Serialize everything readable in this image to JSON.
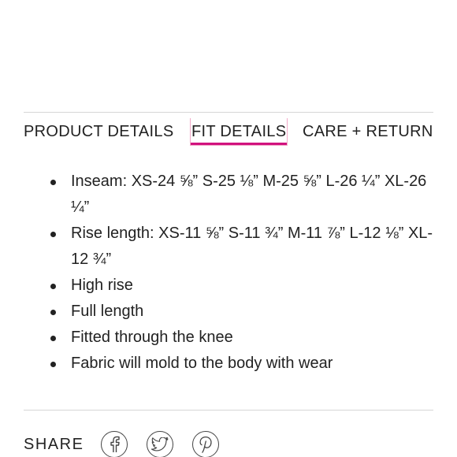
{
  "tabs": [
    {
      "label": "PRODUCT DETAILS",
      "active": false
    },
    {
      "label": "FIT DETAILS",
      "active": true
    },
    {
      "label": "CARE + RETURNS",
      "active": false
    }
  ],
  "fit_details": [
    "Inseam: XS-24 ⅝” S-25 ⅛” M-25 ⅝” L-26 ¼” XL-26 ¼”",
    "Rise length: XS-11 ⅝” S-11 ¾” M-11 ⅞” L-12 ⅛” XL-12 ¾”",
    "High rise",
    "Full length",
    "Fitted through the knee",
    "Fabric will mold to the body with wear"
  ],
  "share": {
    "label": "SHARE",
    "icons": [
      "facebook-icon",
      "twitter-icon",
      "pinterest-icon"
    ]
  },
  "colors": {
    "active_tab_underline": "#d1127e",
    "text": "#222222",
    "divider": "#d6d6d6"
  }
}
